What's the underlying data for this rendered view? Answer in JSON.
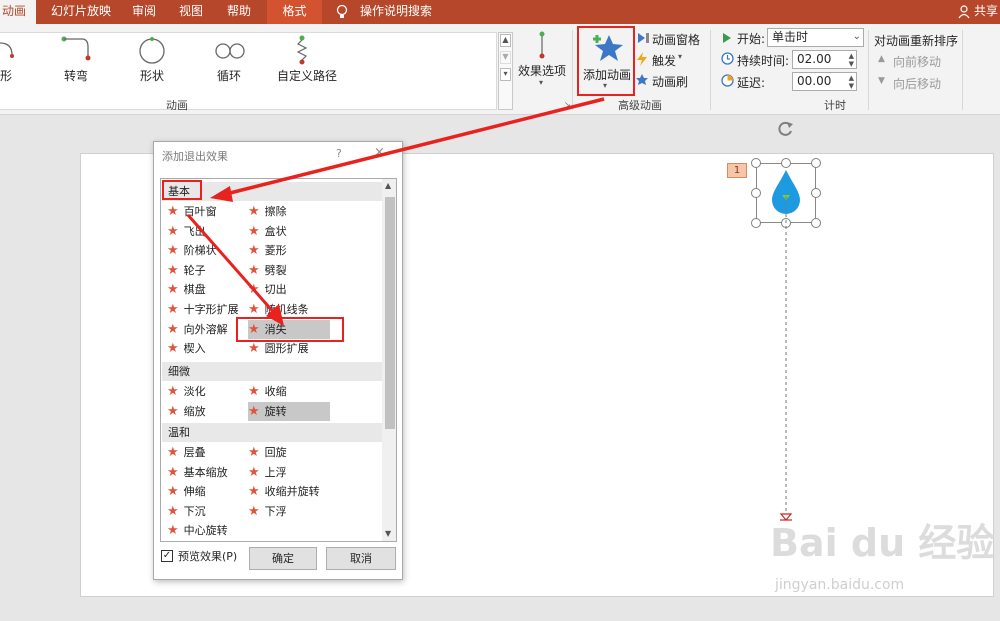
{
  "tabs": {
    "animation": "动画",
    "slideshow": "幻灯片放映",
    "review": "审阅",
    "view": "视图",
    "help": "帮助",
    "format": "格式",
    "tellme": "操作说明搜索",
    "share": "共享"
  },
  "ribbon": {
    "gallery": {
      "partial": "形",
      "turn": "转弯",
      "shape": "形状",
      "loop": "循环",
      "custom": "自定义路径"
    },
    "group_animation": "动画",
    "effect_options": "效果选项",
    "add_animation": "添加动画",
    "animation_pane": "动画窗格",
    "trigger": "触发",
    "animation_painter": "动画刷",
    "group_advanced": "高级动画",
    "start_label": "开始:",
    "start_value": "单击时",
    "duration_label": "持续时间:",
    "duration_value": "02.00",
    "delay_label": "延迟:",
    "delay_value": "00.00",
    "group_timing": "计时",
    "reorder_title": "对动画重新排序",
    "move_earlier": "向前移动",
    "move_later": "向后移动"
  },
  "dialog": {
    "title": "添加退出效果",
    "help": "?",
    "close": "×",
    "categories": {
      "basic": "基本",
      "subtle": "细微",
      "moderate": "温和"
    },
    "basic_effects": [
      "百叶窗",
      "擦除",
      "飞出",
      "盒状",
      "阶梯状",
      "菱形",
      "轮子",
      "劈裂",
      "棋盘",
      "切出",
      "十字形扩展",
      "随机线条",
      "向外溶解",
      "消失",
      "楔入",
      "圆形扩展"
    ],
    "subtle_effects": [
      "淡化",
      "收缩",
      "缩放",
      "旋转"
    ],
    "moderate_effects": [
      "层叠",
      "回旋",
      "基本缩放",
      "上浮",
      "伸缩",
      "收缩并旋转",
      "下沉",
      "下浮",
      "中心旋转"
    ],
    "preview_label": "预览效果(P)",
    "preview_checked": true,
    "ok": "确定",
    "cancel": "取消"
  },
  "slide": {
    "anim_badge": "1"
  },
  "watermark": {
    "brand": "Bai du 经验",
    "url": "jingyan.baidu.com"
  },
  "colors": {
    "accent": "#b7472a",
    "highlight": "#e8221e",
    "star": "#e0553a",
    "drop": "#1e9be0"
  }
}
